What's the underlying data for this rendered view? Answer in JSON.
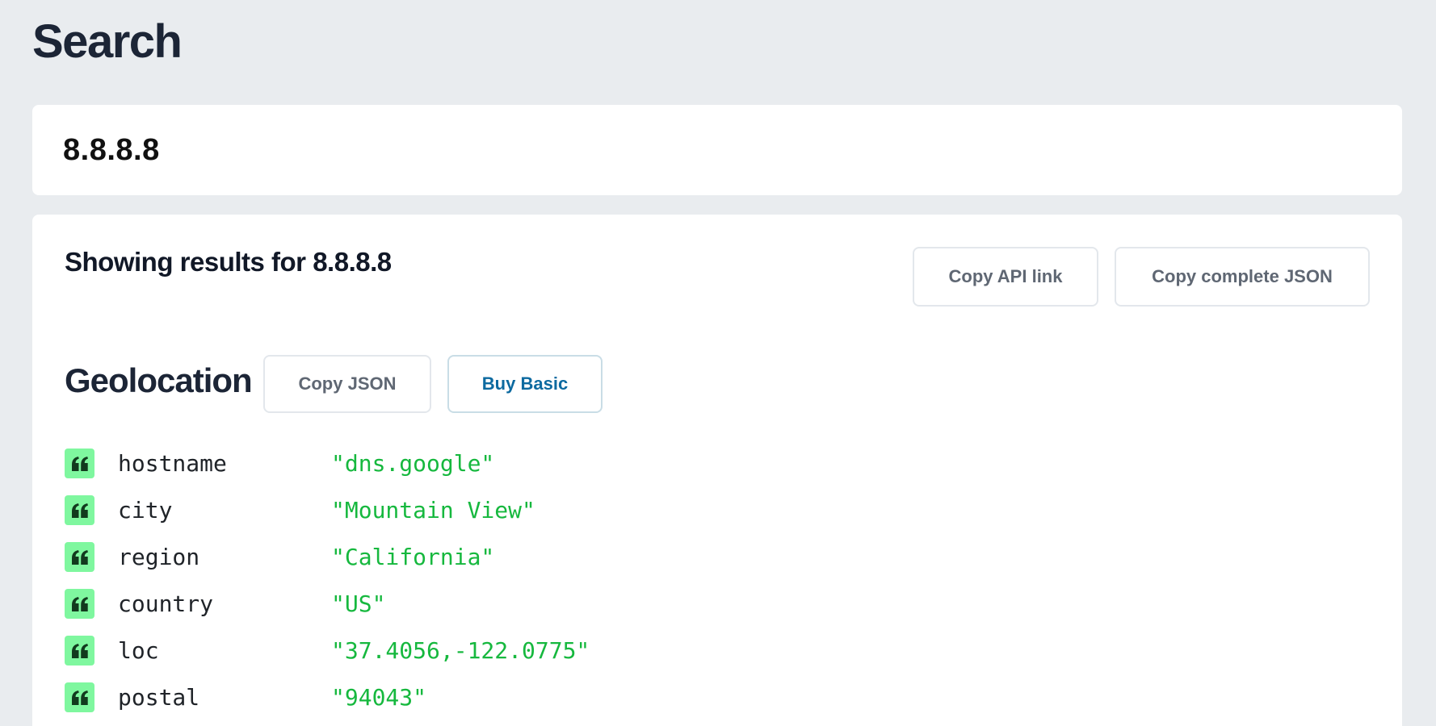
{
  "page": {
    "title": "Search"
  },
  "search": {
    "value": "8.8.8.8"
  },
  "results": {
    "heading": "Showing results for 8.8.8.8",
    "copy_api_link_label": "Copy API link",
    "copy_complete_json_label": "Copy complete JSON"
  },
  "geolocation": {
    "title": "Geolocation",
    "copy_json_label": "Copy JSON",
    "buy_basic_label": "Buy Basic",
    "fields": [
      {
        "key": "hostname",
        "value": "\"dns.google\"",
        "icon": "quote-icon"
      },
      {
        "key": "city",
        "value": "\"Mountain View\"",
        "icon": "quote-icon"
      },
      {
        "key": "region",
        "value": "\"California\"",
        "icon": "quote-icon"
      },
      {
        "key": "country",
        "value": "\"US\"",
        "icon": "quote-icon"
      },
      {
        "key": "loc",
        "value": "\"37.4056,-122.0775\"",
        "icon": "quote-icon"
      },
      {
        "key": "postal",
        "value": "\"94043\"",
        "icon": "quote-icon"
      }
    ]
  },
  "colors": {
    "background": "#e9ecef",
    "accent_green": "#7ff79f",
    "value_green": "#16b83e",
    "link_blue": "#0d6aa0"
  }
}
